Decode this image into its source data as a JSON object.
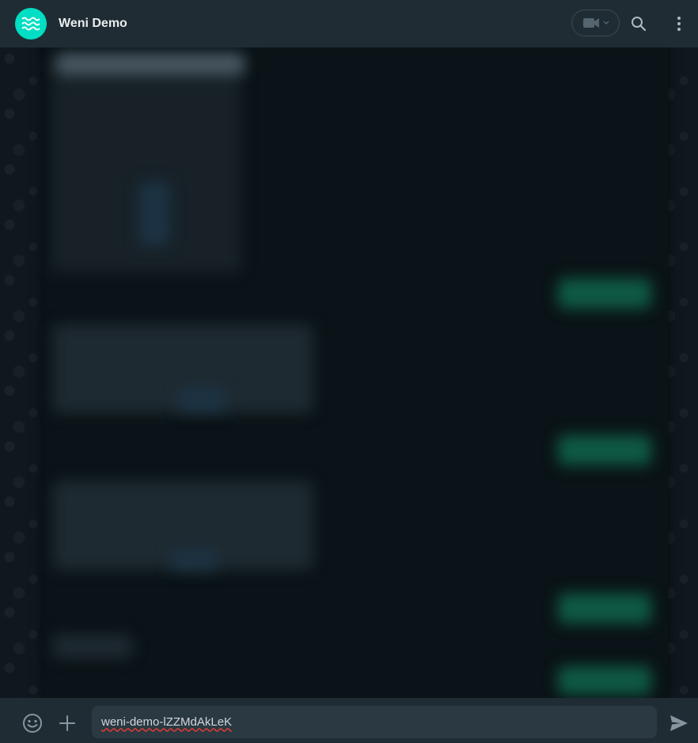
{
  "header": {
    "contact_name": "Weni Demo",
    "avatar": {
      "icon": "weni-waves-icon",
      "color": "#00dec3"
    },
    "actions": [
      {
        "icon": "video-camera-icon"
      },
      {
        "icon": "search-icon"
      },
      {
        "icon": "menu-dots-icon"
      }
    ]
  },
  "composer": {
    "value": "weni-demo-lZZMdAkLeK",
    "emoji_icon": "emoji-icon",
    "attach_icon": "plus-icon",
    "send_icon": "send-icon"
  },
  "colors": {
    "header_bg": "#202c33",
    "chat_bg": "#0b141a",
    "incoming_bubble": "#1e2a31",
    "outgoing_bubble": "#0f5a45",
    "accent": "#00dec3"
  }
}
